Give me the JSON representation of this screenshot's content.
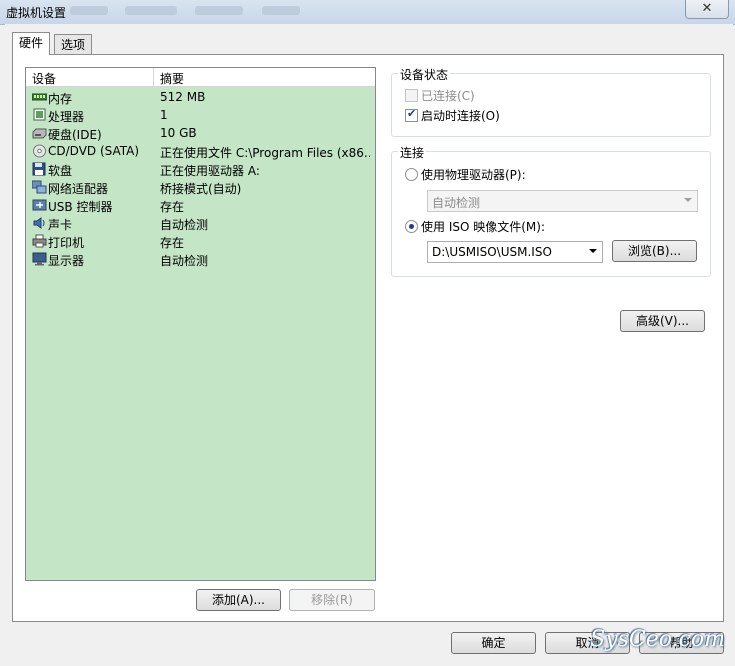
{
  "window": {
    "title": "虚拟机设置",
    "close_glyph": "✕"
  },
  "tabs": [
    {
      "label": "硬件",
      "active": true
    },
    {
      "label": "选项",
      "active": false
    }
  ],
  "device_list": {
    "columns": [
      "设备",
      "摘要"
    ],
    "rows": [
      {
        "name": "内存",
        "summary": "512 MB",
        "icon": "memory-icon"
      },
      {
        "name": "处理器",
        "summary": "1",
        "icon": "processor-icon"
      },
      {
        "name": "硬盘(IDE)",
        "summary": "10 GB",
        "icon": "hard-disk-icon"
      },
      {
        "name": "CD/DVD (SATA)",
        "summary": "正在使用文件 C:\\Program Files (x86...",
        "icon": "cd-dvd-icon"
      },
      {
        "name": "软盘",
        "summary": "正在使用驱动器 A:",
        "icon": "floppy-icon"
      },
      {
        "name": "网络适配器",
        "summary": "桥接模式(自动)",
        "icon": "network-adapter-icon"
      },
      {
        "name": "USB 控制器",
        "summary": "存在",
        "icon": "usb-icon"
      },
      {
        "name": "声卡",
        "summary": "自动检测",
        "icon": "sound-card-icon"
      },
      {
        "name": "打印机",
        "summary": "存在",
        "icon": "printer-icon"
      },
      {
        "name": "显示器",
        "summary": "自动检测",
        "icon": "display-icon"
      }
    ]
  },
  "buttons": {
    "add": "添加(A)...",
    "remove": "移除(R)",
    "browse": "浏览(B)...",
    "advanced": "高级(V)...",
    "ok": "确定",
    "cancel": "取消",
    "help": "帮助"
  },
  "device_status": {
    "title": "设备状态",
    "connected": {
      "label": "已连接(C)",
      "checked": false,
      "enabled": false
    },
    "connect_at_power_on": {
      "label": "启动时连接(O)",
      "checked": true,
      "enabled": true
    }
  },
  "connection": {
    "title": "连接",
    "physical_drive": {
      "label": "使用物理驱动器(P):",
      "selected": false,
      "value": "自动检测"
    },
    "iso_image": {
      "label": "使用 ISO 映像文件(M):",
      "selected": true,
      "value": "D:\\USMISO\\USM.ISO"
    }
  },
  "watermark": "SysCeo.com",
  "colors": {
    "device_list_bg": "#c5e6c6",
    "titlebar": "#d9e4f1"
  }
}
